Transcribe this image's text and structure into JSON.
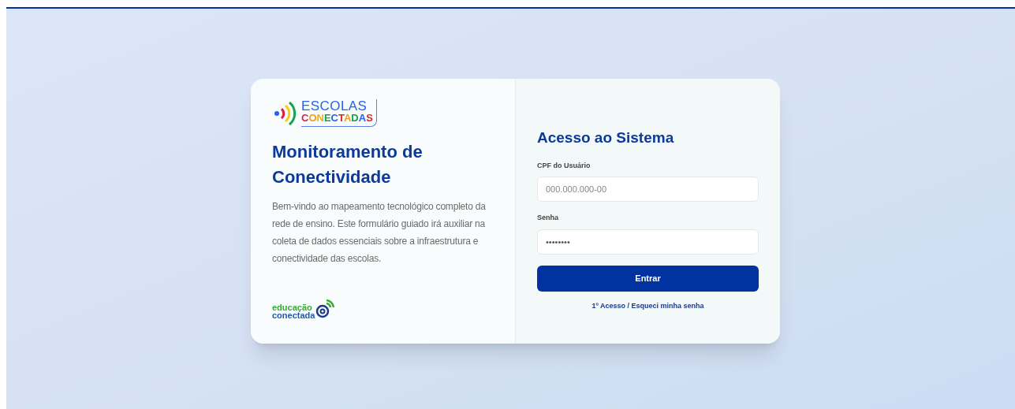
{
  "brand_logo": {
    "line_1": "ESCOLAS",
    "line_2": "CONECTADAS"
  },
  "intro": {
    "title": "Monitoramento de Conectividade",
    "text": "Bem-vindo ao mapeamento tecnológico completo da rede de ensino. Este formulário guiado irá auxiliar na coleta de dados essenciais sobre a infraestrutura e conectividade das escolas."
  },
  "footer_logo": {
    "line_1": "educação",
    "line_2": "conectada"
  },
  "login": {
    "title": "Acesso ao Sistema",
    "fields": [
      {
        "label": "CPF do Usuário",
        "placeholder": "000.000.000-00",
        "kind": "text"
      },
      {
        "label": "Senha",
        "placeholder": "••••••••",
        "kind": "password"
      }
    ],
    "submit": "Entrar",
    "link": "1º Acesso / Esqueci minha senha"
  }
}
